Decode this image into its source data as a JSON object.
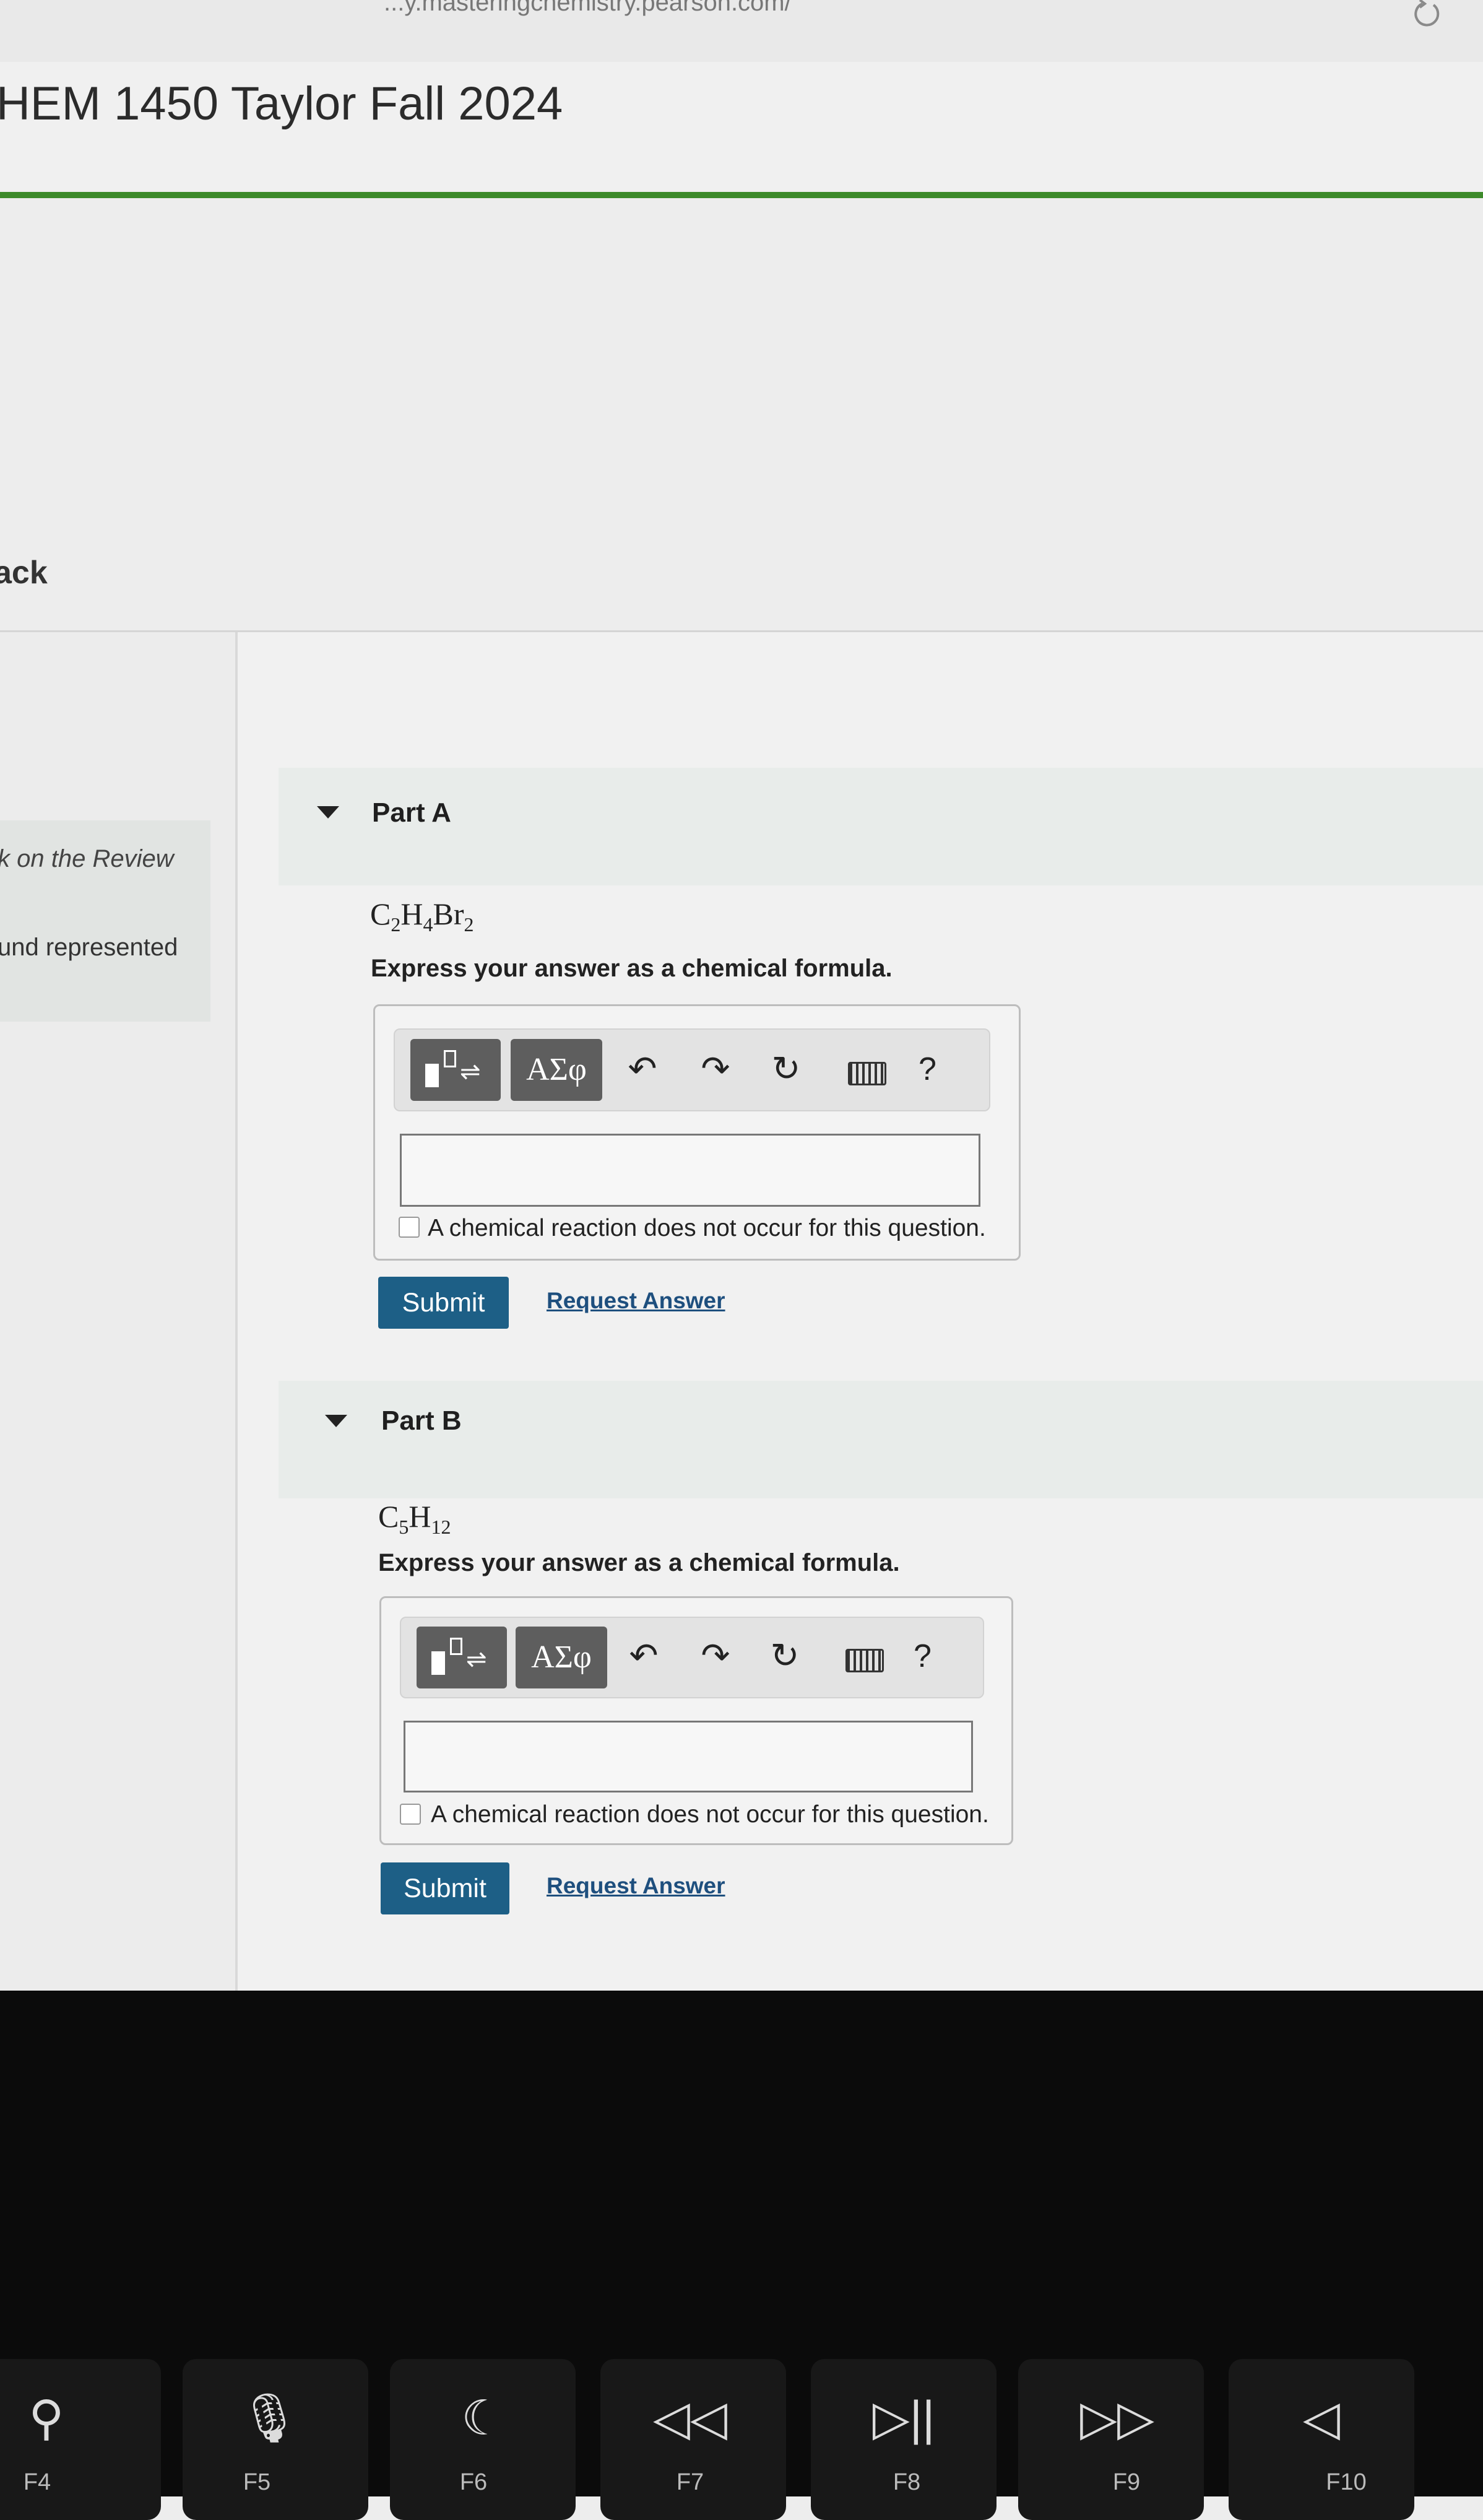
{
  "browser": {
    "url_fragment": "...y.masteringchemistry.pearson.com/",
    "reload_icon": "reload-icon"
  },
  "course": {
    "title": "HEM 1450 Taylor Fall 2024"
  },
  "nav": {
    "back_label": "ack"
  },
  "sidebar": {
    "line1": "k on the Review",
    "line2": "und represented"
  },
  "colors": {
    "accent_green": "#3d8a2b",
    "submit_blue": "#1d5f86",
    "link_blue": "#1e4f7e"
  },
  "parts": [
    {
      "title": "Part A",
      "formula": {
        "el1": "C",
        "n1": "2",
        "el2": "H",
        "n2": "4",
        "el3": "Br",
        "n3": "2"
      },
      "instruction": "Express your answer as a chemical formula.",
      "toolbar": {
        "greek_label": "ΑΣφ",
        "help_label": "?"
      },
      "input_value": "",
      "no_reaction_label": "A chemical reaction does not occur for this question.",
      "submit_label": "Submit",
      "request_label": "Request Answer"
    },
    {
      "title": "Part B",
      "formula": {
        "el1": "C",
        "n1": "5",
        "el2": "H",
        "n2": "12"
      },
      "instruction": "Express your answer as a chemical formula.",
      "toolbar": {
        "greek_label": "ΑΣφ",
        "help_label": "?"
      },
      "input_value": "",
      "no_reaction_label": "A chemical reaction does not occur for this question.",
      "submit_label": "Submit",
      "request_label": "Request Answer"
    }
  ],
  "keyboard": {
    "keys": [
      {
        "icon": "search-icon",
        "glyph": "⚲",
        "label": "F4"
      },
      {
        "icon": "microphone-icon",
        "glyph": "🎙",
        "label": "F5"
      },
      {
        "icon": "moon-icon",
        "glyph": "☾",
        "label": "F6"
      },
      {
        "icon": "rewind-icon",
        "glyph": "◁◁",
        "label": "F7"
      },
      {
        "icon": "play-pause-icon",
        "glyph": "▷||",
        "label": "F8"
      },
      {
        "icon": "fast-forward-icon",
        "glyph": "▷▷",
        "label": "F9"
      },
      {
        "icon": "mute-icon",
        "glyph": "◁",
        "label": "F10"
      }
    ]
  }
}
